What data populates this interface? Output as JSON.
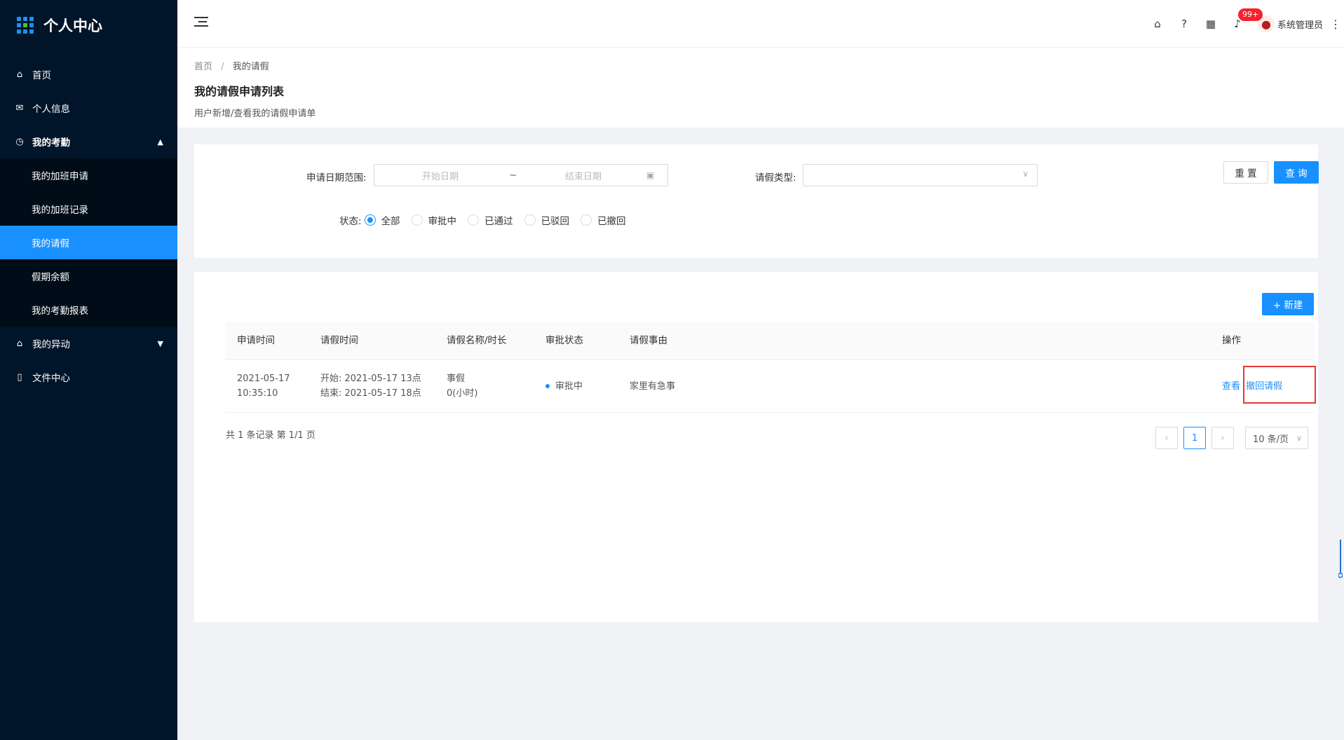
{
  "app": {
    "title": "个人中心"
  },
  "sidebar": {
    "items": [
      {
        "label": "首页",
        "icon": "home-icon"
      },
      {
        "label": "个人信息",
        "icon": "mail-icon"
      },
      {
        "label": "我的考勤",
        "icon": "clock-icon",
        "expanded": true
      },
      {
        "label": "我的异动",
        "icon": "bank-icon",
        "expanded": false
      },
      {
        "label": "文件中心",
        "icon": "file-icon"
      }
    ],
    "submenu": [
      {
        "label": "我的加班申请"
      },
      {
        "label": "我的加班记录"
      },
      {
        "label": "我的请假",
        "active": true
      },
      {
        "label": "假期余额"
      },
      {
        "label": "我的考勤报表"
      }
    ]
  },
  "header": {
    "badge": "99+",
    "username": "系统管理员"
  },
  "breadcrumb": {
    "home": "首页",
    "current": "我的请假"
  },
  "page": {
    "title": "我的请假申请列表",
    "description": "用户新增/查看我的请假申请单"
  },
  "filter": {
    "date_label": "申请日期范围:",
    "start_placeholder": "开始日期",
    "range_sep": "~",
    "end_placeholder": "结束日期",
    "type_label": "请假类型:",
    "type_value": "",
    "status_label": "状态:",
    "status_options": [
      "全部",
      "审批中",
      "已通过",
      "已驳回",
      "已撤回"
    ],
    "status_selected": "全部",
    "reset_label": "重 置",
    "query_label": "查 询"
  },
  "table": {
    "new_button": "+ 新建",
    "columns": [
      "申请时间",
      "请假时间",
      "请假名称/时长",
      "审批状态",
      "请假事由",
      "操作"
    ],
    "rows": [
      {
        "apply_date": "2021-05-17",
        "apply_time": "10:35:10",
        "start": "开始: 2021-05-17 13点",
        "end": "结束: 2021-05-17 18点",
        "leave_name": "事假",
        "leave_duration": "0(小时)",
        "status": "审批中",
        "reason": "家里有急事",
        "action_view": "查看",
        "action_withdraw": "撤回请假"
      }
    ]
  },
  "pagination": {
    "summary": "共 1 条记录 第 1/1 页",
    "current_page": "1",
    "page_size": "10 条/页"
  },
  "colors": {
    "primary": "#1890ff",
    "sidebar": "#001529",
    "highlight": "#e53935"
  }
}
